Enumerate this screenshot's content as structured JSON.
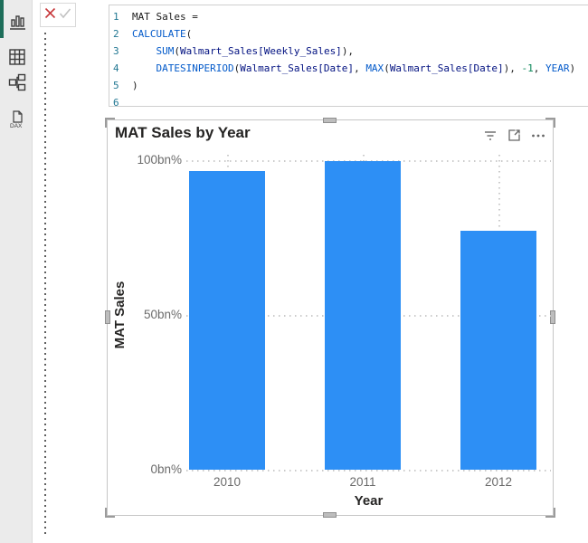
{
  "colors": {
    "bar_fill": "#2D8FF5",
    "sidebar_accent": "#1E6E5A",
    "dax_function_blue": "#035ACA",
    "dax_reference_navy": "#001080",
    "dax_number_green": "#098658",
    "line_number_blue": "#237893",
    "cancel_red": "#C8393C"
  },
  "sidebar": {
    "views": [
      {
        "name": "report-view",
        "active": true
      },
      {
        "name": "table-view",
        "active": false
      },
      {
        "name": "model-view",
        "active": false
      },
      {
        "name": "dax-query-view",
        "active": false,
        "label": "DAX"
      }
    ]
  },
  "formula_bar": {
    "commit_icons": [
      "cancel-x",
      "commit-check"
    ]
  },
  "editor": {
    "lines": [
      {
        "num": "1",
        "tokens": [
          [
            "plain",
            "MAT Sales ="
          ]
        ]
      },
      {
        "num": "2",
        "tokens": [
          [
            "fn",
            "CALCULATE"
          ],
          [
            "plain",
            "("
          ]
        ]
      },
      {
        "num": "3",
        "tokens": [
          [
            "plain",
            "    "
          ],
          [
            "fn",
            "SUM"
          ],
          [
            "plain",
            "("
          ],
          [
            "ref",
            "Walmart_Sales[Weekly_Sales]"
          ],
          [
            "plain",
            "),"
          ]
        ]
      },
      {
        "num": "4",
        "tokens": [
          [
            "plain",
            "    "
          ],
          [
            "fn",
            "DATESINPERIOD"
          ],
          [
            "plain",
            "("
          ],
          [
            "ref",
            "Walmart_Sales[Date]"
          ],
          [
            "plain",
            ", "
          ],
          [
            "fn",
            "MAX"
          ],
          [
            "plain",
            "("
          ],
          [
            "ref",
            "Walmart_Sales[Date]"
          ],
          [
            "plain",
            "), "
          ],
          [
            "num",
            "-1"
          ],
          [
            "plain",
            ", "
          ],
          [
            "fn",
            "YEAR"
          ],
          [
            "plain",
            ")"
          ]
        ]
      },
      {
        "num": "5",
        "tokens": [
          [
            "plain",
            ")"
          ]
        ]
      },
      {
        "num": "6",
        "tokens": []
      }
    ]
  },
  "visual": {
    "title": "MAT Sales by Year",
    "header_icons": [
      "filter",
      "focus-mode",
      "more-options"
    ]
  },
  "chart_data": {
    "type": "bar",
    "title": "MAT Sales by Year",
    "categories": [
      "2010",
      "2011",
      "2012"
    ],
    "values": [
      96.5,
      99.7,
      77.2
    ],
    "xlabel": "Year",
    "ylabel": "MAT Sales",
    "y_ticks": [
      {
        "value": 0,
        "label": "0bn%"
      },
      {
        "value": 50,
        "label": "50bn%"
      },
      {
        "value": 100,
        "label": "100bn%"
      }
    ],
    "ylim": [
      0,
      100
    ],
    "grid": "dotted",
    "legend": "none",
    "bar_color": "#2D8FF5"
  }
}
